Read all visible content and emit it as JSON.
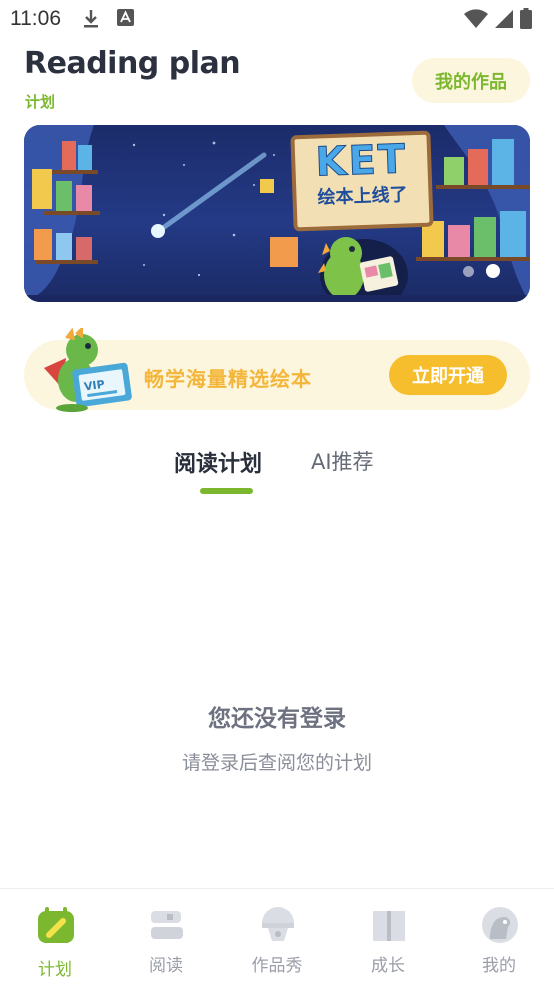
{
  "status_bar": {
    "time": "11:06"
  },
  "header": {
    "title": "Reading plan",
    "subtitle": "计划",
    "works_button": "我的作品"
  },
  "banner": {
    "sign_title": "KET",
    "sign_subtitle": "绘本上线了",
    "slides": 2,
    "active_slide": 2
  },
  "vip": {
    "badge": "VIP",
    "text": "畅学海量精选绘本",
    "button": "立即开通"
  },
  "tabs": [
    {
      "label": "阅读计划",
      "active": true
    },
    {
      "label": "AI推荐",
      "active": false
    }
  ],
  "empty_state": {
    "title": "您还没有登录",
    "description": "请登录后查阅您的计划"
  },
  "bottom_nav": [
    {
      "label": "计划",
      "icon": "plan-icon",
      "active": true
    },
    {
      "label": "阅读",
      "icon": "books-icon",
      "active": false
    },
    {
      "label": "作品秀",
      "icon": "showcase-icon",
      "active": false
    },
    {
      "label": "成长",
      "icon": "growth-book-icon",
      "active": false
    },
    {
      "label": "我的",
      "icon": "profile-dino-icon",
      "active": false
    }
  ],
  "colors": {
    "accent_green": "#7cb82f",
    "vip_yellow": "#f6bd2d",
    "cream": "#fdf6df"
  }
}
